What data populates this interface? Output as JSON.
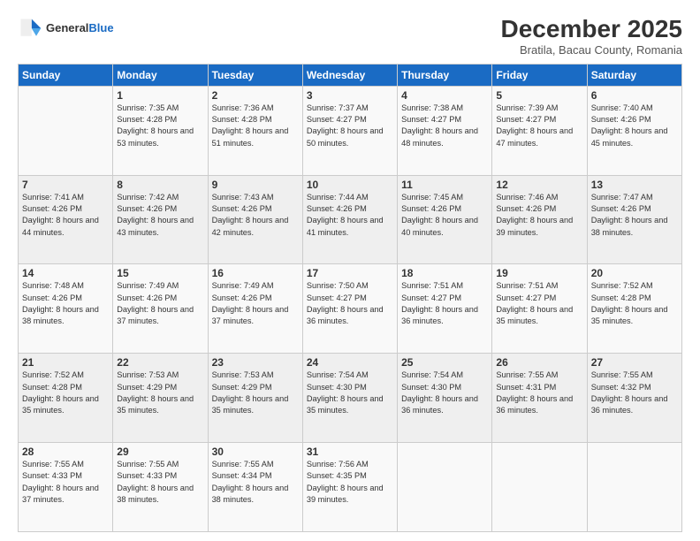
{
  "header": {
    "logo_line1": "General",
    "logo_line2": "Blue",
    "month": "December 2025",
    "location": "Bratila, Bacau County, Romania"
  },
  "days_of_week": [
    "Sunday",
    "Monday",
    "Tuesday",
    "Wednesday",
    "Thursday",
    "Friday",
    "Saturday"
  ],
  "weeks": [
    [
      {
        "day": "",
        "sunrise": "",
        "sunset": "",
        "daylight": ""
      },
      {
        "day": "1",
        "sunrise": "Sunrise: 7:35 AM",
        "sunset": "Sunset: 4:28 PM",
        "daylight": "Daylight: 8 hours and 53 minutes."
      },
      {
        "day": "2",
        "sunrise": "Sunrise: 7:36 AM",
        "sunset": "Sunset: 4:28 PM",
        "daylight": "Daylight: 8 hours and 51 minutes."
      },
      {
        "day": "3",
        "sunrise": "Sunrise: 7:37 AM",
        "sunset": "Sunset: 4:27 PM",
        "daylight": "Daylight: 8 hours and 50 minutes."
      },
      {
        "day": "4",
        "sunrise": "Sunrise: 7:38 AM",
        "sunset": "Sunset: 4:27 PM",
        "daylight": "Daylight: 8 hours and 48 minutes."
      },
      {
        "day": "5",
        "sunrise": "Sunrise: 7:39 AM",
        "sunset": "Sunset: 4:27 PM",
        "daylight": "Daylight: 8 hours and 47 minutes."
      },
      {
        "day": "6",
        "sunrise": "Sunrise: 7:40 AM",
        "sunset": "Sunset: 4:26 PM",
        "daylight": "Daylight: 8 hours and 45 minutes."
      }
    ],
    [
      {
        "day": "7",
        "sunrise": "Sunrise: 7:41 AM",
        "sunset": "Sunset: 4:26 PM",
        "daylight": "Daylight: 8 hours and 44 minutes."
      },
      {
        "day": "8",
        "sunrise": "Sunrise: 7:42 AM",
        "sunset": "Sunset: 4:26 PM",
        "daylight": "Daylight: 8 hours and 43 minutes."
      },
      {
        "day": "9",
        "sunrise": "Sunrise: 7:43 AM",
        "sunset": "Sunset: 4:26 PM",
        "daylight": "Daylight: 8 hours and 42 minutes."
      },
      {
        "day": "10",
        "sunrise": "Sunrise: 7:44 AM",
        "sunset": "Sunset: 4:26 PM",
        "daylight": "Daylight: 8 hours and 41 minutes."
      },
      {
        "day": "11",
        "sunrise": "Sunrise: 7:45 AM",
        "sunset": "Sunset: 4:26 PM",
        "daylight": "Daylight: 8 hours and 40 minutes."
      },
      {
        "day": "12",
        "sunrise": "Sunrise: 7:46 AM",
        "sunset": "Sunset: 4:26 PM",
        "daylight": "Daylight: 8 hours and 39 minutes."
      },
      {
        "day": "13",
        "sunrise": "Sunrise: 7:47 AM",
        "sunset": "Sunset: 4:26 PM",
        "daylight": "Daylight: 8 hours and 38 minutes."
      }
    ],
    [
      {
        "day": "14",
        "sunrise": "Sunrise: 7:48 AM",
        "sunset": "Sunset: 4:26 PM",
        "daylight": "Daylight: 8 hours and 38 minutes."
      },
      {
        "day": "15",
        "sunrise": "Sunrise: 7:49 AM",
        "sunset": "Sunset: 4:26 PM",
        "daylight": "Daylight: 8 hours and 37 minutes."
      },
      {
        "day": "16",
        "sunrise": "Sunrise: 7:49 AM",
        "sunset": "Sunset: 4:26 PM",
        "daylight": "Daylight: 8 hours and 37 minutes."
      },
      {
        "day": "17",
        "sunrise": "Sunrise: 7:50 AM",
        "sunset": "Sunset: 4:27 PM",
        "daylight": "Daylight: 8 hours and 36 minutes."
      },
      {
        "day": "18",
        "sunrise": "Sunrise: 7:51 AM",
        "sunset": "Sunset: 4:27 PM",
        "daylight": "Daylight: 8 hours and 36 minutes."
      },
      {
        "day": "19",
        "sunrise": "Sunrise: 7:51 AM",
        "sunset": "Sunset: 4:27 PM",
        "daylight": "Daylight: 8 hours and 35 minutes."
      },
      {
        "day": "20",
        "sunrise": "Sunrise: 7:52 AM",
        "sunset": "Sunset: 4:28 PM",
        "daylight": "Daylight: 8 hours and 35 minutes."
      }
    ],
    [
      {
        "day": "21",
        "sunrise": "Sunrise: 7:52 AM",
        "sunset": "Sunset: 4:28 PM",
        "daylight": "Daylight: 8 hours and 35 minutes."
      },
      {
        "day": "22",
        "sunrise": "Sunrise: 7:53 AM",
        "sunset": "Sunset: 4:29 PM",
        "daylight": "Daylight: 8 hours and 35 minutes."
      },
      {
        "day": "23",
        "sunrise": "Sunrise: 7:53 AM",
        "sunset": "Sunset: 4:29 PM",
        "daylight": "Daylight: 8 hours and 35 minutes."
      },
      {
        "day": "24",
        "sunrise": "Sunrise: 7:54 AM",
        "sunset": "Sunset: 4:30 PM",
        "daylight": "Daylight: 8 hours and 35 minutes."
      },
      {
        "day": "25",
        "sunrise": "Sunrise: 7:54 AM",
        "sunset": "Sunset: 4:30 PM",
        "daylight": "Daylight: 8 hours and 36 minutes."
      },
      {
        "day": "26",
        "sunrise": "Sunrise: 7:55 AM",
        "sunset": "Sunset: 4:31 PM",
        "daylight": "Daylight: 8 hours and 36 minutes."
      },
      {
        "day": "27",
        "sunrise": "Sunrise: 7:55 AM",
        "sunset": "Sunset: 4:32 PM",
        "daylight": "Daylight: 8 hours and 36 minutes."
      }
    ],
    [
      {
        "day": "28",
        "sunrise": "Sunrise: 7:55 AM",
        "sunset": "Sunset: 4:33 PM",
        "daylight": "Daylight: 8 hours and 37 minutes."
      },
      {
        "day": "29",
        "sunrise": "Sunrise: 7:55 AM",
        "sunset": "Sunset: 4:33 PM",
        "daylight": "Daylight: 8 hours and 38 minutes."
      },
      {
        "day": "30",
        "sunrise": "Sunrise: 7:55 AM",
        "sunset": "Sunset: 4:34 PM",
        "daylight": "Daylight: 8 hours and 38 minutes."
      },
      {
        "day": "31",
        "sunrise": "Sunrise: 7:56 AM",
        "sunset": "Sunset: 4:35 PM",
        "daylight": "Daylight: 8 hours and 39 minutes."
      },
      {
        "day": "",
        "sunrise": "",
        "sunset": "",
        "daylight": ""
      },
      {
        "day": "",
        "sunrise": "",
        "sunset": "",
        "daylight": ""
      },
      {
        "day": "",
        "sunrise": "",
        "sunset": "",
        "daylight": ""
      }
    ]
  ]
}
